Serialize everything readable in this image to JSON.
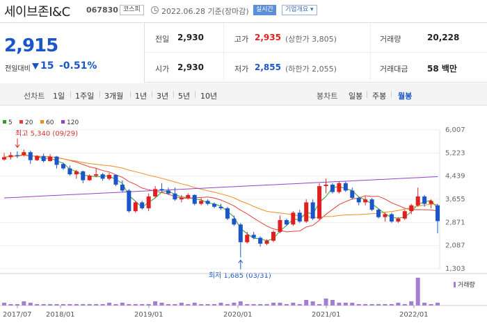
{
  "header": {
    "stock_name": "세이브존I&C",
    "stock_code": "067830",
    "market": "코스피",
    "date_text": "2022.06.28 기준(장마감)",
    "realtime_label": "실시간",
    "company_label": "기업개요 ▾"
  },
  "price": {
    "current": "2,915",
    "change_label": "전일대비",
    "change_amount": "15",
    "change_percent": "-0.51%"
  },
  "stats": {
    "prev_close_label": "전일",
    "prev_close": "2,930",
    "high_label": "고가",
    "high": "2,935",
    "high_sub": "(상한가 3,805)",
    "volume_label": "거래량",
    "volume": "20,228",
    "open_label": "시가",
    "open": "2,930",
    "low_label": "저가",
    "low": "2,855",
    "low_sub": "(하한가 2,055)",
    "amount_label": "거래대금",
    "amount": "58 백만"
  },
  "periods": {
    "line_title": "선차트",
    "line_items": [
      "1일",
      "1주일",
      "3개월",
      "1년",
      "3년",
      "5년",
      "10년"
    ],
    "candle_title": "봉차트",
    "candle_items": [
      "일봉",
      "주봉",
      "월봉"
    ],
    "candle_active": 2
  },
  "colors": {
    "up": "#e02020",
    "down": "#1a56c9",
    "ma5": "#2e9e2e",
    "ma20": "#e0403a",
    "ma60": "#f08c1a",
    "ma120": "#9440c8",
    "volume": "#a47ed0"
  },
  "chart_data": {
    "type": "candlestick",
    "legend": [
      {
        "name": "5",
        "color": "#2e9e2e"
      },
      {
        "name": "20",
        "color": "#e0403a"
      },
      {
        "name": "60",
        "color": "#f08c1a"
      },
      {
        "name": "120",
        "color": "#9440c8"
      }
    ],
    "y_ticks": [
      6007,
      5223,
      4439,
      3655,
      2871,
      2087,
      1303
    ],
    "ylim": [
      1303,
      6007
    ],
    "x_ticks": [
      "2017/07",
      "2018/01",
      "2019/01",
      "2020/01",
      "2021/01",
      "2022/01"
    ],
    "high_annotation": "최고 5,340 (09/29)",
    "low_annotation": "최저 1,685 (03/31)",
    "volume_label": "거래량",
    "candles": [
      [
        5000,
        5220,
        4960,
        5080
      ],
      [
        5080,
        5250,
        5000,
        5150
      ],
      [
        5150,
        5280,
        5050,
        5120
      ],
      [
        5150,
        5340,
        5100,
        5250
      ],
      [
        5250,
        5300,
        4850,
        4980
      ],
      [
        4980,
        5150,
        4950,
        5120
      ],
      [
        5120,
        5200,
        4900,
        4950
      ],
      [
        4950,
        5180,
        4930,
        5100
      ],
      [
        5100,
        5120,
        4700,
        4820
      ],
      [
        4850,
        4900,
        4650,
        4700
      ],
      [
        4700,
        4800,
        4450,
        4500
      ],
      [
        4500,
        4650,
        4350,
        4600
      ],
      [
        4600,
        4620,
        4200,
        4300
      ],
      [
        4300,
        4500,
        4280,
        4450
      ],
      [
        4450,
        4700,
        4400,
        4500
      ],
      [
        4500,
        4550,
        4280,
        4350
      ],
      [
        4350,
        4550,
        4300,
        4480
      ],
      [
        4480,
        4500,
        4100,
        4150
      ],
      [
        4150,
        4300,
        3900,
        3950
      ],
      [
        3950,
        4000,
        3200,
        3250
      ],
      [
        3250,
        3600,
        3200,
        3550
      ],
      [
        3550,
        3600,
        3300,
        3350
      ],
      [
        3350,
        3850,
        3250,
        3750
      ],
      [
        3750,
        4100,
        3700,
        4000
      ],
      [
        4000,
        4200,
        3900,
        3950
      ],
      [
        3950,
        4050,
        3800,
        3850
      ],
      [
        3850,
        4050,
        3600,
        3650
      ],
      [
        3650,
        3800,
        3550,
        3700
      ],
      [
        3700,
        3850,
        3650,
        3800
      ],
      [
        3800,
        3820,
        3450,
        3500
      ],
      [
        3500,
        3700,
        3450,
        3600
      ],
      [
        3600,
        3650,
        3450,
        3500
      ],
      [
        3500,
        3550,
        3350,
        3400
      ],
      [
        3400,
        3500,
        3300,
        3350
      ],
      [
        3350,
        3400,
        2950,
        3000
      ],
      [
        3000,
        3100,
        2750,
        2800
      ],
      [
        2800,
        2850,
        1685,
        2200
      ],
      [
        2200,
        2550,
        2150,
        2450
      ],
      [
        2450,
        2550,
        2300,
        2350
      ],
      [
        2350,
        2400,
        2050,
        2150
      ],
      [
        2150,
        2300,
        2100,
        2250
      ],
      [
        2250,
        2600,
        2200,
        2550
      ],
      [
        2550,
        3100,
        2500,
        2950
      ],
      [
        2950,
        3000,
        2750,
        2800
      ],
      [
        2800,
        3250,
        2750,
        3200
      ],
      [
        3200,
        3300,
        2850,
        2900
      ],
      [
        2900,
        3650,
        2850,
        3550
      ],
      [
        3550,
        3650,
        2950,
        3000
      ],
      [
        3000,
        4200,
        2950,
        4100
      ],
      [
        4100,
        4350,
        3850,
        4150
      ],
      [
        4150,
        4200,
        3850,
        3900
      ],
      [
        3900,
        4250,
        3850,
        4200
      ],
      [
        4200,
        4250,
        3900,
        3950
      ],
      [
        3950,
        4050,
        3650,
        3700
      ],
      [
        3700,
        3750,
        3450,
        3550
      ],
      [
        3550,
        3750,
        3450,
        3650
      ],
      [
        3650,
        3700,
        3250,
        3300
      ],
      [
        3300,
        3350,
        3000,
        3050
      ],
      [
        3050,
        3200,
        2900,
        3150
      ],
      [
        3150,
        3200,
        2850,
        2900
      ],
      [
        2900,
        3050,
        2850,
        3000
      ],
      [
        3000,
        3300,
        2950,
        3250
      ],
      [
        3250,
        3500,
        3150,
        3450
      ],
      [
        3450,
        4050,
        3400,
        3750
      ],
      [
        3750,
        3800,
        3400,
        3500
      ],
      [
        3500,
        3650,
        3350,
        3600
      ],
      [
        3450,
        3500,
        2500,
        2915
      ]
    ],
    "volumes": [
      2,
      1,
      1,
      3,
      2,
      1,
      1,
      1,
      1,
      1,
      1,
      1,
      1,
      1,
      1,
      1,
      2,
      1,
      2,
      1,
      1,
      1,
      1,
      3,
      2,
      1,
      1,
      2,
      1,
      2,
      1,
      1,
      1,
      2,
      1,
      2,
      3,
      1,
      1,
      1,
      1,
      2,
      2,
      1,
      2,
      1,
      4,
      3,
      1,
      5,
      4,
      2,
      2,
      2,
      1,
      1,
      1,
      1,
      1,
      1,
      2,
      1,
      3,
      20,
      2,
      1,
      2
    ]
  }
}
